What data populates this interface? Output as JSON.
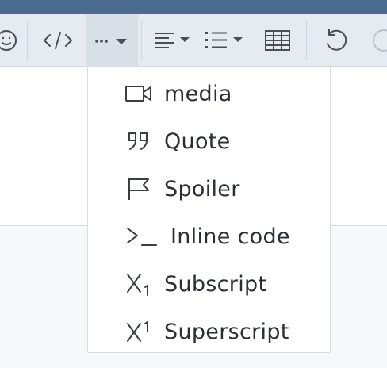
{
  "toolbar": {
    "buttons": [
      {
        "name": "emoji-button",
        "icon": "emoji-icon"
      },
      {
        "name": "code-button",
        "icon": "code-icon"
      },
      {
        "name": "more-button",
        "icon": "more-dots-icon",
        "active": true
      },
      {
        "name": "align-button",
        "icon": "align-icon"
      },
      {
        "name": "list-button",
        "icon": "list-icon"
      },
      {
        "name": "table-button",
        "icon": "table-icon"
      },
      {
        "name": "undo-button",
        "icon": "undo-icon"
      },
      {
        "name": "redo-button",
        "icon": "redo-icon"
      }
    ]
  },
  "dropdown": {
    "items": [
      {
        "label": "media",
        "icon": "video-icon"
      },
      {
        "label": "Quote",
        "icon": "quote-icon"
      },
      {
        "label": "Spoiler",
        "icon": "flag-icon"
      },
      {
        "label": "Inline code",
        "icon": "terminal-icon"
      },
      {
        "label": "Subscript",
        "icon": "subscript-icon"
      },
      {
        "label": "Superscript",
        "icon": "superscript-icon"
      }
    ]
  },
  "colors": {
    "accent_bar": "#4b6a8f",
    "toolbar_bg": "#e6ebf1",
    "active_btn_bg": "#d8dfe7",
    "menu_text": "#2b2e33"
  }
}
